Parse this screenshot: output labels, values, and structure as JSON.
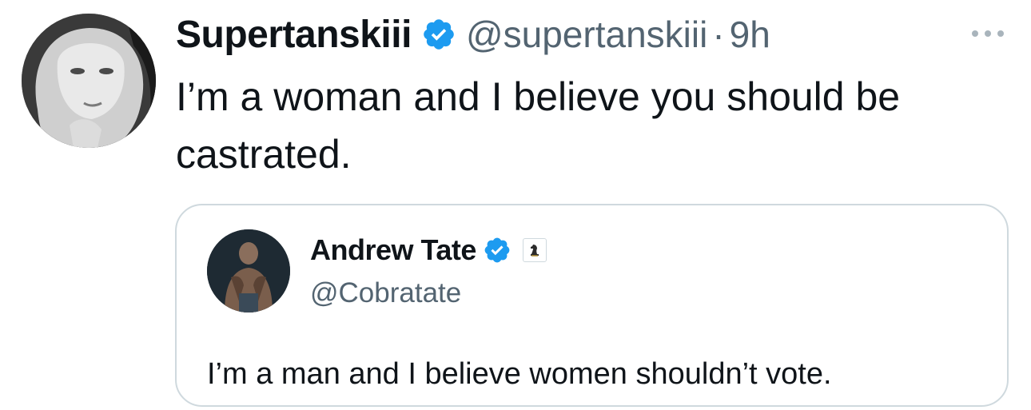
{
  "tweet": {
    "display_name": "Supertanskiii",
    "handle": "@supertanskiii",
    "separator": "·",
    "time": "9h",
    "text": "I’m a woman and I believe you should be castrated.",
    "verified": true,
    "icons": {
      "avatar": "profile-photo",
      "verified": "verified-badge-icon",
      "more": "more-options-icon"
    }
  },
  "quoted_tweet": {
    "display_name": "Andrew Tate",
    "handle": "@Cobratate",
    "text": "I’m a man and I believe women shouldn’t vote.",
    "verified": true,
    "icons": {
      "avatar": "profile-photo",
      "verified": "verified-badge-icon",
      "affiliate": "chess-knight-icon"
    }
  },
  "colors": {
    "text_primary": "#0f1419",
    "text_secondary": "#536471",
    "verified_blue": "#1d9bf0",
    "border": "#cfd9de"
  }
}
